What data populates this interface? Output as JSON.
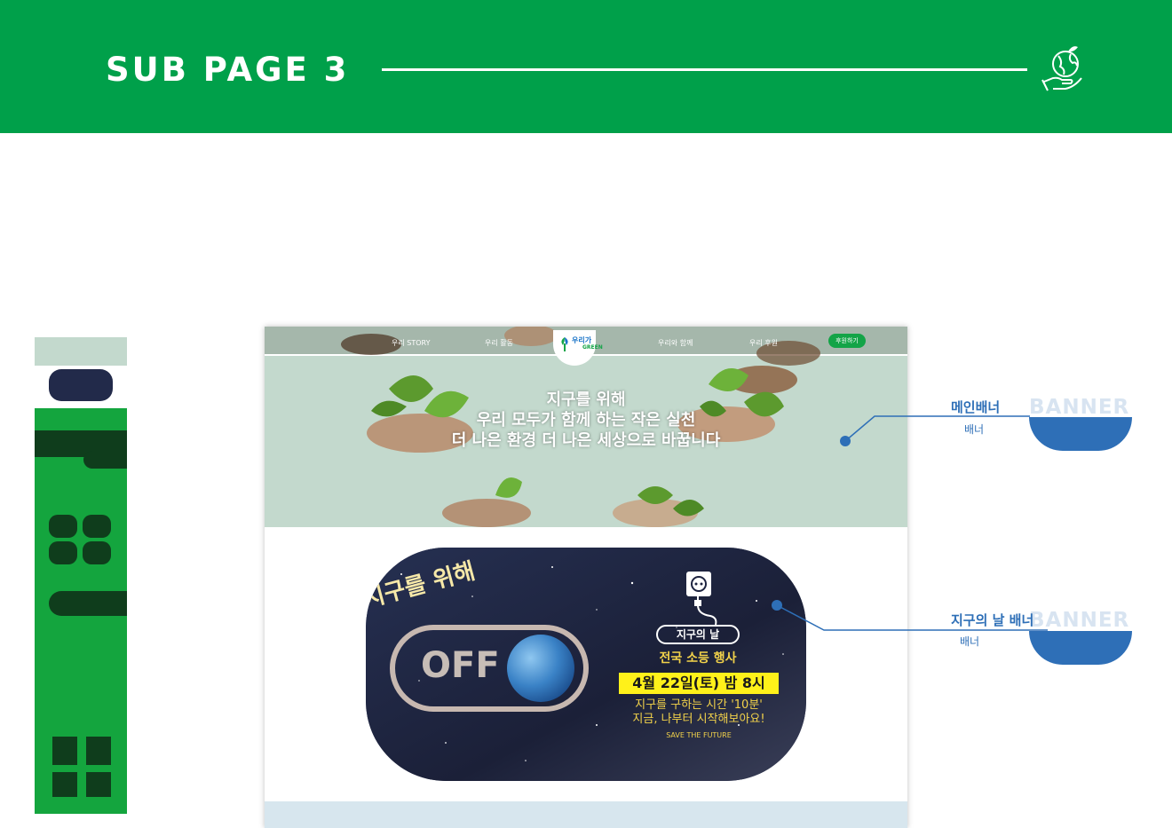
{
  "header": {
    "title": "SUB PAGE 3",
    "icon": "globe-hand-icon"
  },
  "mockup": {
    "nav": [
      {
        "label": "우리 STORY"
      },
      {
        "label": "우리 활동"
      },
      {
        "label": "우리와 함께"
      },
      {
        "label": "우리 후원"
      }
    ],
    "logo": {
      "line1": "우리가",
      "line2": "GREEN"
    },
    "donate_label": "후원하기",
    "hero_lines": [
      "지구를 위해",
      "우리 모두가 함께 하는 작은 실천",
      "더 나은 환경 더 나은 세상으로 바꿉니다"
    ],
    "earth_banner": {
      "tagline": "지구를 위해",
      "off_label": "OFF",
      "event_badge": "지구의 날",
      "event_title": "전국 소등 행사",
      "event_date": "4월 22일(토) 밤 8시",
      "desc_line1": "지구를 구하는 시간 '10분'",
      "desc_line2": "지금, 나부터 시작해보아요!",
      "save_text": "SAVE THE FUTURE"
    }
  },
  "callouts": [
    {
      "title": "메인배너",
      "sub": "배너",
      "watermark": "BANNER"
    },
    {
      "title": "지구의 날 배너",
      "sub": "배너",
      "watermark": "BANNER"
    }
  ],
  "colors": {
    "header_green": "#00a04a",
    "callout_blue": "#2e6fb7",
    "hero_mint": "#c3d9cd",
    "banner_navy": "#1d2340",
    "event_yellow": "#fff11a"
  }
}
